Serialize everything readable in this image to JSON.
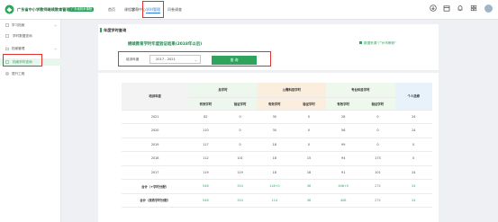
{
  "header": {
    "brand": "广东省中小学教师继续教育管理系统",
    "badge": "广东省校本课程",
    "nav": [
      "首页",
      "课程超市",
      "学习中心",
      "学时管理",
      "问卷调查"
    ],
    "active_nav_index": 3
  },
  "sidebar": {
    "items": [
      {
        "label": "学习档案",
        "expandable": true
      },
      {
        "label": "学时数据查询",
        "sub": true
      },
      {
        "label": "档案管理",
        "expandable": true
      },
      {
        "label": "档案学时查询",
        "sub": true,
        "active": true
      },
      {
        "label": "提升工程"
      }
    ]
  },
  "main": {
    "section_title": "年度学时查询",
    "sub_title": "继续教育学时年度验证结果(2018年以后)",
    "data_source": "数据来源“广州市教研”",
    "filter_label": "培训年度",
    "year_value": "2017 - 2021",
    "query_button": "查 询"
  },
  "table": {
    "year_header": "培训年度",
    "groups": [
      "总学时",
      "公需科目学时",
      "专业科目学时",
      "个人选修"
    ],
    "sub_headers": [
      "有效学时",
      "验证学时",
      "有效学时",
      "验证学时",
      "有效学时",
      "验证学时"
    ],
    "rows": [
      [
        "2021",
        "82",
        "0",
        "30",
        "0",
        "28",
        "0",
        "24"
      ],
      [
        "2020",
        "110",
        "0",
        "30",
        "0",
        "56",
        "0",
        "24"
      ],
      [
        "2019",
        "117",
        "0",
        "18",
        "0",
        "99",
        "0",
        "0"
      ],
      [
        "2018",
        "112",
        "101",
        "18",
        "15",
        "94",
        "173",
        "0"
      ],
      [
        "2017",
        "119",
        "119",
        "18",
        "18",
        "91",
        "101",
        "24"
      ]
    ],
    "totals": [
      [
        "合计（+学时分配）",
        "546",
        "310",
        "114+0",
        "36",
        "408+0",
        "274",
        "24"
      ],
      [
        "合计（按改学时分配）",
        "546",
        "310",
        "114",
        "36",
        "408",
        "274",
        "24"
      ]
    ]
  }
}
